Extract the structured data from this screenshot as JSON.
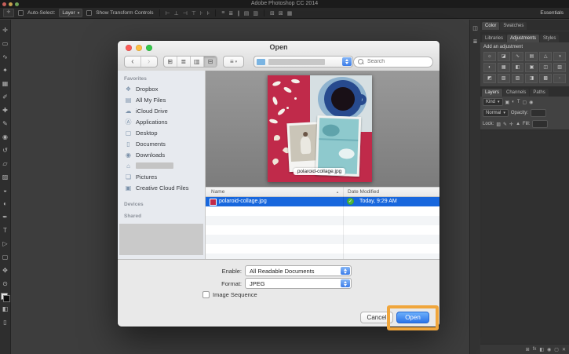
{
  "colors": {
    "selection_blue": "#1867DD",
    "primary_button_blue": "#2B74E9",
    "annotation_orange": "#F0A63C",
    "artwork_crimson": "#C02A4A",
    "traffic_red": "#FC5B57",
    "traffic_yellow": "#FDBE41",
    "traffic_green": "#34C84A"
  },
  "photoshop": {
    "menubar": {
      "title": "Adobe Photoshop CC 2014"
    },
    "options_bar": {
      "auto_select_label": "Auto-Select:",
      "auto_select_target": "Layer",
      "dropdown_chevron": "▾",
      "show_transform_label": "Show Transform Controls",
      "icon_group_1": [
        "⊢",
        "⊥",
        "⊣",
        "⊤",
        "⊦",
        "⊧"
      ],
      "icon_group_2": [
        "≡",
        "≣",
        "∥",
        "▤",
        "▥"
      ],
      "icon_group_3": [
        "⊞",
        "⊠",
        "▦"
      ],
      "workspace": "Essentials"
    },
    "tools": [
      {
        "name": "move-tool",
        "glyph": "✛"
      },
      {
        "name": "marquee-tool",
        "glyph": "▭"
      },
      {
        "name": "lasso-tool",
        "glyph": "∿"
      },
      {
        "name": "quick-selection-tool",
        "glyph": "✦"
      },
      {
        "name": "crop-tool",
        "glyph": "▦"
      },
      {
        "name": "eyedropper-tool",
        "glyph": "✐"
      },
      {
        "name": "healing-brush-tool",
        "glyph": "✚"
      },
      {
        "name": "brush-tool",
        "glyph": "✎"
      },
      {
        "name": "clone-stamp-tool",
        "glyph": "◉"
      },
      {
        "name": "history-brush-tool",
        "glyph": "↺"
      },
      {
        "name": "eraser-tool",
        "glyph": "▱"
      },
      {
        "name": "gradient-tool",
        "glyph": "▨"
      },
      {
        "name": "blur-tool",
        "glyph": "◒"
      },
      {
        "name": "dodge-tool",
        "glyph": "◐"
      },
      {
        "name": "pen-tool",
        "glyph": "✒"
      },
      {
        "name": "type-tool",
        "glyph": "T"
      },
      {
        "name": "path-selection-tool",
        "glyph": "▷"
      },
      {
        "name": "shape-tool",
        "glyph": "▢"
      },
      {
        "name": "hand-tool",
        "glyph": "✥"
      },
      {
        "name": "zoom-tool",
        "glyph": "⊙"
      }
    ],
    "extra_tools": [
      {
        "name": "quick-mask-icon",
        "glyph": "◧"
      },
      {
        "name": "screen-mode-icon",
        "glyph": "▯"
      }
    ],
    "dock_strip_icons": [
      "◫",
      "≣"
    ],
    "dock": {
      "color_swatches_tabs": [
        "Color",
        "Swatches"
      ],
      "libraries_tabs": [
        "Libraries",
        "Adjustments",
        "Styles"
      ],
      "add_adjustment_label": "Add an adjustment",
      "adjustment_icons": [
        "☼",
        "◪",
        "∿",
        "▤",
        "△",
        "◑",
        "◐",
        "▦",
        "◧",
        "▣",
        "◫",
        "▥",
        "◩",
        "▧",
        "▨",
        "◨",
        "▩",
        "◦"
      ],
      "layers_tabs": [
        "Layers",
        "Channels",
        "Paths"
      ],
      "kind_filter_label": "Kind",
      "filter_icons": [
        "▣",
        "◐",
        "T",
        "▢",
        "◉"
      ],
      "blend_mode_value": "Normal",
      "opacity_label": "Opacity:",
      "lock_label": "Lock:",
      "lock_icons": [
        "▨",
        "✎",
        "✛",
        "▲"
      ],
      "fill_label": "Fill:",
      "bottom_icons": [
        {
          "name": "link-layers-icon",
          "glyph": "⊞"
        },
        {
          "name": "layer-effects-icon",
          "glyph": "fx"
        },
        {
          "name": "layer-mask-icon",
          "glyph": "◧"
        },
        {
          "name": "adjustment-layer-icon",
          "glyph": "◉"
        },
        {
          "name": "new-layer-icon",
          "glyph": "▢"
        },
        {
          "name": "delete-layer-icon",
          "glyph": "✕"
        }
      ]
    }
  },
  "dialog": {
    "title": "Open",
    "toolbar": {
      "back_glyph": "‹",
      "forward_glyph": "›",
      "view_glyphs": [
        "⊞",
        "≣",
        "▥",
        "⊟"
      ],
      "arrange_glyph": "≡",
      "arrange_chevron": "▾",
      "search_placeholder": "Search"
    },
    "sidebar": {
      "favorites_label": "Favorites",
      "items": [
        {
          "label": "Dropbox",
          "icon": "❖"
        },
        {
          "label": "All My Files",
          "icon": "▤"
        },
        {
          "label": "iCloud Drive",
          "icon": "☁"
        },
        {
          "label": "Applications",
          "icon": "Ⓐ"
        },
        {
          "label": "Desktop",
          "icon": "▢"
        },
        {
          "label": "Documents",
          "icon": "▯"
        },
        {
          "label": "Downloads",
          "icon": "◉"
        },
        {
          "label": "",
          "icon": "⌂",
          "redacted": true
        },
        {
          "label": "Pictures",
          "icon": "❏"
        },
        {
          "label": "Creative Cloud Files",
          "icon": "▣"
        }
      ],
      "devices_label": "Devices",
      "shared_label": "Shared"
    },
    "preview": {
      "caption": "polaroid-collage.jpg"
    },
    "list": {
      "columns": [
        "Name",
        "Date Modified"
      ],
      "sort_caret": "▲",
      "rows": [
        {
          "name": "polaroid-collage.jpg",
          "date_modified": "Today, 9:29 AM",
          "badge": "✓"
        }
      ]
    },
    "footer": {
      "enable_label": "Enable:",
      "enable_value": "All Readable Documents",
      "format_label": "Format:",
      "format_value": "JPEG",
      "image_sequence_label": "Image Sequence",
      "cancel_label": "Cancel",
      "open_label": "Open"
    }
  }
}
